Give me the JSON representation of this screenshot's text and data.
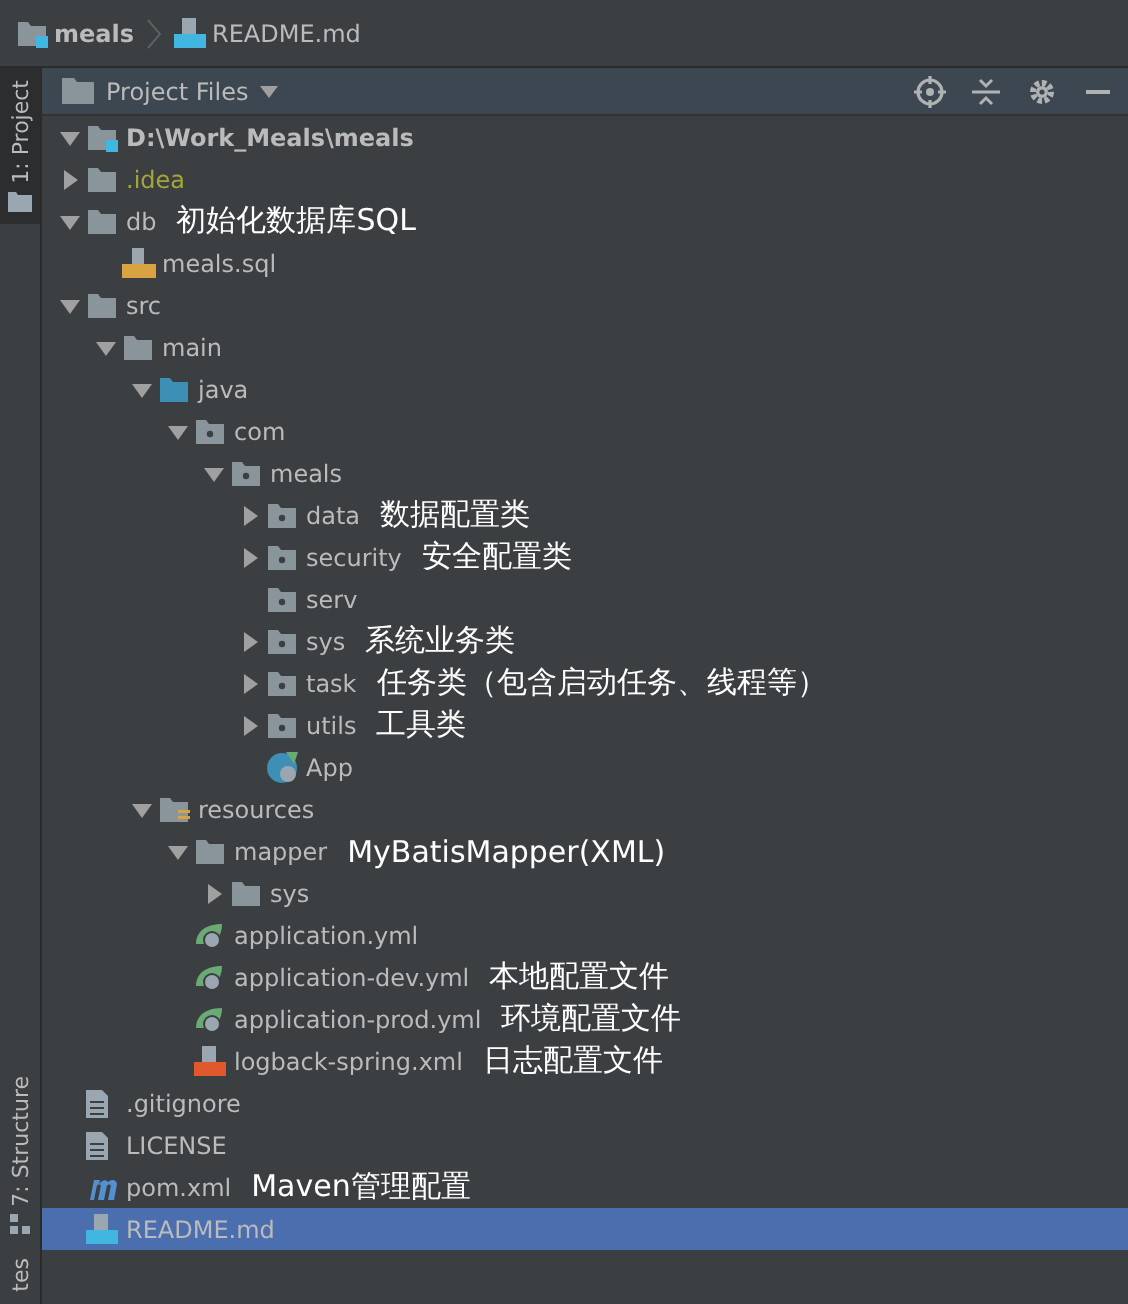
{
  "breadcrumb": [
    {
      "label": "meals",
      "kind": "module"
    },
    {
      "label": "README.md",
      "kind": "markdown"
    }
  ],
  "side_tabs": {
    "top": [
      {
        "label": "1: Project",
        "selected": true
      }
    ],
    "bottom": [
      {
        "label": "7: Structure",
        "selected": false
      },
      {
        "label": "tes",
        "selected": false
      }
    ]
  },
  "toolbar": {
    "title": "Project Files"
  },
  "tree": [
    {
      "name": "D:\\Work_Meals\\meals",
      "kind": "module",
      "expanded": true,
      "selected": false,
      "children": [
        {
          "name": ".idea",
          "kind": "folder",
          "expanded": false,
          "selected": false,
          "excluded": true
        },
        {
          "name": "db",
          "kind": "folder",
          "expanded": true,
          "selected": false,
          "note": "初始化数据库SQL",
          "children": [
            {
              "name": "meals.sql",
              "kind": "sql",
              "selected": false
            }
          ]
        },
        {
          "name": "src",
          "kind": "folder",
          "expanded": true,
          "selected": false,
          "children": [
            {
              "name": "main",
              "kind": "folder",
              "expanded": true,
              "selected": false,
              "children": [
                {
                  "name": "java",
                  "kind": "source",
                  "expanded": true,
                  "selected": false,
                  "children": [
                    {
                      "name": "com",
                      "kind": "package",
                      "expanded": true,
                      "selected": false,
                      "children": [
                        {
                          "name": "meals",
                          "kind": "package",
                          "expanded": true,
                          "selected": false,
                          "children": [
                            {
                              "name": "data",
                              "kind": "package",
                              "expanded": false,
                              "selected": false,
                              "note": "数据配置类"
                            },
                            {
                              "name": "security",
                              "kind": "package",
                              "expanded": false,
                              "selected": false,
                              "note": "安全配置类"
                            },
                            {
                              "name": "serv",
                              "kind": "package",
                              "selected": false
                            },
                            {
                              "name": "sys",
                              "kind": "package",
                              "expanded": false,
                              "selected": false,
                              "note": "系统业务类"
                            },
                            {
                              "name": "task",
                              "kind": "package",
                              "expanded": false,
                              "selected": false,
                              "note": "任务类（包含启动任务、线程等）"
                            },
                            {
                              "name": "utils",
                              "kind": "package",
                              "expanded": false,
                              "selected": false,
                              "note": "工具类"
                            },
                            {
                              "name": "App",
                              "kind": "spring-class",
                              "selected": false
                            }
                          ]
                        }
                      ]
                    }
                  ]
                },
                {
                  "name": "resources",
                  "kind": "resources",
                  "expanded": true,
                  "selected": false,
                  "children": [
                    {
                      "name": "mapper",
                      "kind": "folder",
                      "expanded": true,
                      "selected": false,
                      "note": "MyBatisMapper(XML)",
                      "children": [
                        {
                          "name": "sys",
                          "kind": "folder",
                          "expanded": false,
                          "selected": false
                        }
                      ]
                    },
                    {
                      "name": "application.yml",
                      "kind": "spring",
                      "selected": false
                    },
                    {
                      "name": "application-dev.yml",
                      "kind": "spring",
                      "selected": false,
                      "note": "本地配置文件"
                    },
                    {
                      "name": "application-prod.yml",
                      "kind": "spring",
                      "selected": false,
                      "note": "环境配置文件"
                    },
                    {
                      "name": "logback-spring.xml",
                      "kind": "xml",
                      "selected": false,
                      "note": "日志配置文件"
                    }
                  ]
                }
              ]
            }
          ]
        },
        {
          "name": ".gitignore",
          "kind": "text",
          "selected": false
        },
        {
          "name": "LICENSE",
          "kind": "text",
          "selected": false
        },
        {
          "name": "pom.xml",
          "kind": "maven",
          "selected": false,
          "note": "Maven管理配置"
        },
        {
          "name": "README.md",
          "kind": "markdown",
          "selected": true
        }
      ]
    }
  ]
}
